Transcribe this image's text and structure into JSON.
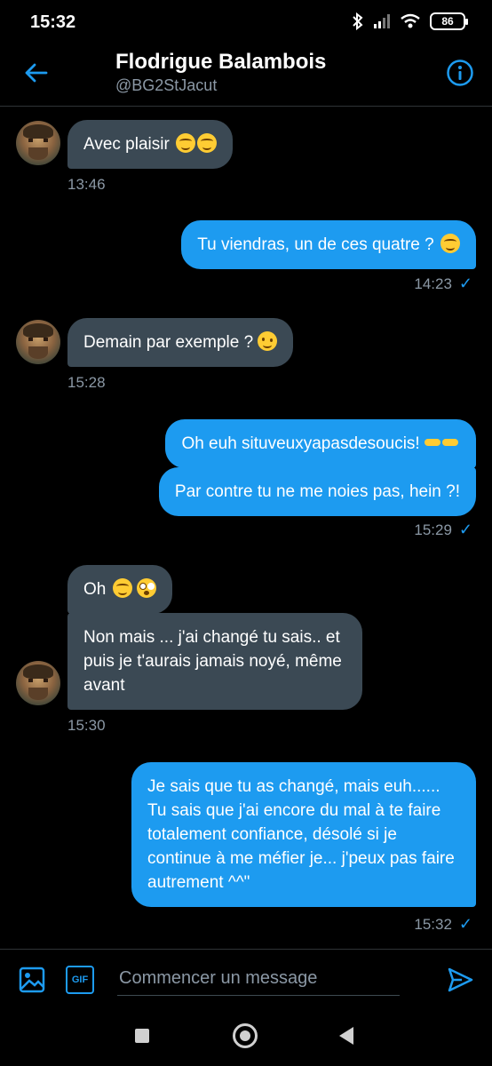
{
  "status_bar": {
    "time": "15:32",
    "battery": "86"
  },
  "header": {
    "name": "Flodrigue Balambois",
    "handle": "@BG2StJacut"
  },
  "messages": [
    {
      "dir": "in",
      "text": "Avec plaisir",
      "emojis": [
        "smiling-face-icon",
        "smiling-face-icon"
      ]
    },
    {
      "dir": "in",
      "time": "13:46"
    },
    {
      "dir": "out",
      "text": "Tu viendras, un de ces quatre ?",
      "emojis": [
        "smiling-face-icon"
      ]
    },
    {
      "dir": "out",
      "time": "14:23"
    },
    {
      "dir": "in",
      "text": "Demain par exemple ?",
      "emojis": [
        "winking-face-icon"
      ]
    },
    {
      "dir": "in",
      "time": "15:28"
    },
    {
      "dir": "out",
      "text": "Oh euh situveuxyapasdesoucis!",
      "emojis": [
        "pointing-hands-icon"
      ]
    },
    {
      "dir": "out",
      "text": "Par contre tu ne me noies pas, hein ?!"
    },
    {
      "dir": "out",
      "time": "15:29"
    },
    {
      "dir": "in",
      "text": "Oh",
      "emojis": [
        "smiling-face-icon",
        "flushed-face-icon"
      ]
    },
    {
      "dir": "in",
      "text": "Non mais ... j'ai changé tu sais.. et puis je t'aurais jamais noyé, même avant"
    },
    {
      "dir": "in",
      "time": "15:30"
    },
    {
      "dir": "out",
      "text": "Je sais que tu as changé, mais euh...... Tu sais que j'ai encore du mal à te faire totalement confiance, désolé si je continue à me méfier je... j'peux pas faire autrement ^^\""
    },
    {
      "dir": "out",
      "time": "15:32"
    }
  ],
  "composer": {
    "placeholder": "Commencer un message",
    "gif_label": "GIF"
  },
  "colors": {
    "accent": "#1d9bf0",
    "incoming_bubble": "#3b4954",
    "background": "#000000"
  }
}
